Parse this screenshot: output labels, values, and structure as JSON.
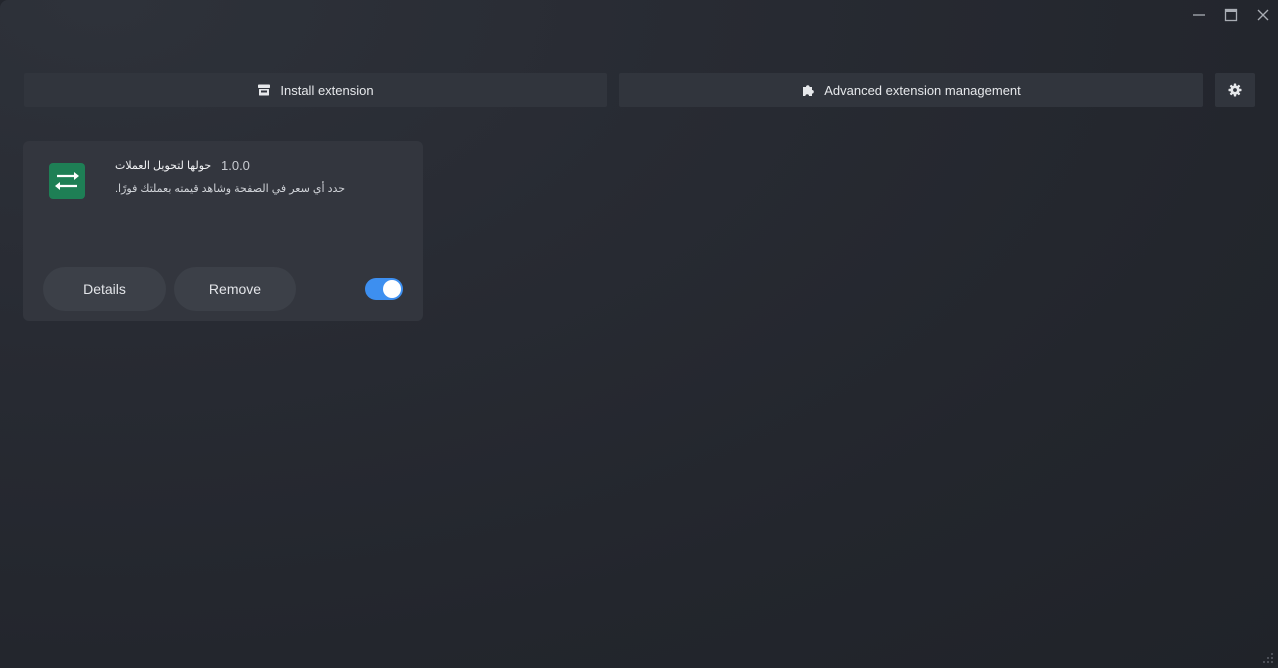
{
  "window": {
    "controls": {
      "minimize": "minimize-icon",
      "maximize": "maximize-icon",
      "close": "close-icon"
    }
  },
  "toolbar": {
    "install_label": "Install extension",
    "advanced_label": "Advanced extension management",
    "install_icon": "store-icon",
    "advanced_icon": "puzzle-icon",
    "settings_icon": "gear-icon"
  },
  "extension": {
    "name": "حولها لتحويل العملات",
    "version": "1.0.0",
    "description": "حدد أي سعر في الصفحة وشاهد قيمته بعملتك فورًا.",
    "icon": "swap-arrows-icon",
    "icon_color": "#1e7f55",
    "enabled": true,
    "details_label": "Details",
    "remove_label": "Remove"
  },
  "colors": {
    "accent": "#3d8ff0",
    "background": "#23262d",
    "card": "#33363e"
  }
}
